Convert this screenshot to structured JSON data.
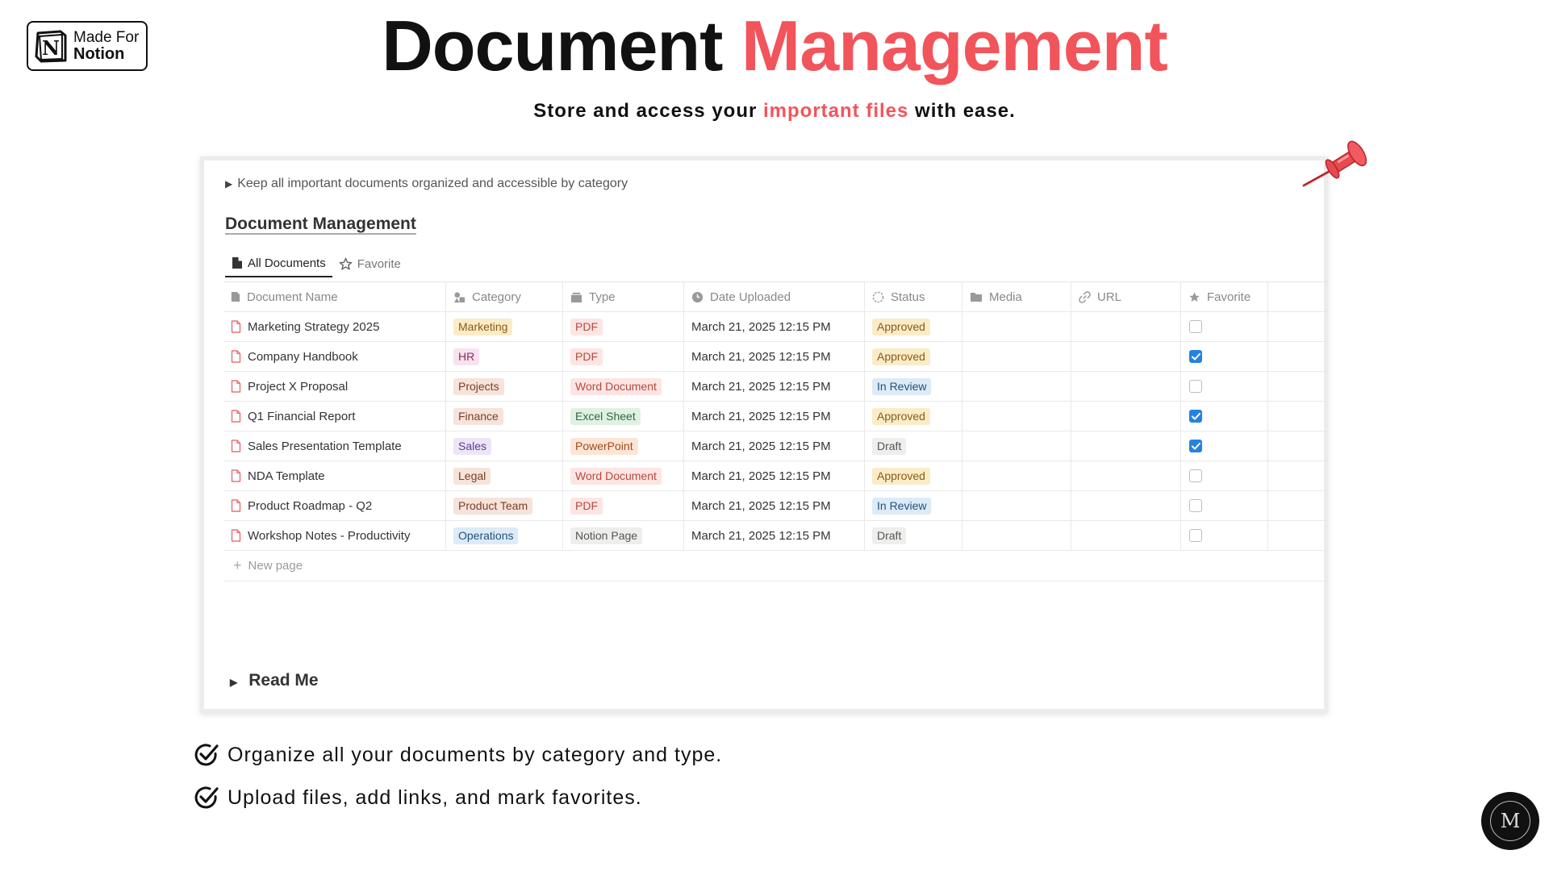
{
  "badge": {
    "line1": "Made For",
    "line2": "Notion",
    "logo_letter": "N"
  },
  "header": {
    "title_plain": "Document",
    "title_accent": "Management",
    "subtitle_pre": "Store and access your",
    "subtitle_accent": "important files",
    "subtitle_post": "with ease."
  },
  "colors": {
    "accent": "#f2545b",
    "checkbox_on": "#2383e2"
  },
  "panel": {
    "toggle_text": "Keep all important documents organized and accessible by category",
    "db_title": "Document Management",
    "tabs": [
      {
        "label": "All Documents",
        "icon": "document-icon",
        "active": true
      },
      {
        "label": "Favorite",
        "icon": "star-icon",
        "active": false
      }
    ],
    "columns": [
      {
        "label": "Document Name",
        "icon": "document-icon"
      },
      {
        "label": "Category",
        "icon": "shapes-icon"
      },
      {
        "label": "Type",
        "icon": "layers-icon"
      },
      {
        "label": "Date Uploaded",
        "icon": "clock-icon"
      },
      {
        "label": "Status",
        "icon": "status-icon"
      },
      {
        "label": "Media",
        "icon": "folder-icon"
      },
      {
        "label": "URL",
        "icon": "link-icon"
      },
      {
        "label": "Favorite",
        "icon": "star-icon"
      }
    ],
    "rows": [
      {
        "name": "Marketing Strategy 2025",
        "category": "Marketing",
        "type": "PDF",
        "date": "March 21, 2025 12:15 PM",
        "status": "Approved",
        "favorite": false
      },
      {
        "name": "Company Handbook",
        "category": "HR",
        "type": "PDF",
        "date": "March 21, 2025 12:15 PM",
        "status": "Approved",
        "favorite": true
      },
      {
        "name": "Project X Proposal",
        "category": "Projects",
        "type": "Word Document",
        "date": "March 21, 2025 12:15 PM",
        "status": "In Review",
        "favorite": false
      },
      {
        "name": "Q1 Financial Report",
        "category": "Finance",
        "type": "Excel Sheet",
        "date": "March 21, 2025 12:15 PM",
        "status": "Approved",
        "favorite": true
      },
      {
        "name": "Sales Presentation Template",
        "category": "Sales",
        "type": "PowerPoint",
        "date": "March 21, 2025 12:15 PM",
        "status": "Draft",
        "favorite": true
      },
      {
        "name": "NDA Template",
        "category": "Legal",
        "type": "Word Document",
        "date": "March 21, 2025 12:15 PM",
        "status": "Approved",
        "favorite": false
      },
      {
        "name": "Product Roadmap - Q2",
        "category": "Product Team",
        "type": "PDF",
        "date": "March 21, 2025 12:15 PM",
        "status": "In Review",
        "favorite": false
      },
      {
        "name": "Workshop Notes - Productivity",
        "category": "Operations",
        "type": "Notion Page",
        "date": "March 21, 2025 12:15 PM",
        "status": "Draft",
        "favorite": false
      }
    ],
    "tag_colors": {
      "Marketing": [
        "#fbecc8",
        "#8a5a14"
      ],
      "HR": [
        "#f9e2ef",
        "#8a2d5e"
      ],
      "Projects": [
        "#f6e3da",
        "#7a3f26"
      ],
      "Finance": [
        "#f6e3da",
        "#7a3f26"
      ],
      "Sales": [
        "#ece4f7",
        "#5b3d8a"
      ],
      "Legal": [
        "#f6e3da",
        "#7a3f26"
      ],
      "Product Team": [
        "#f6e3da",
        "#7a3f26"
      ],
      "Operations": [
        "#dcebf7",
        "#22527a"
      ],
      "PDF": [
        "#fde5e3",
        "#b34a3f"
      ],
      "Word Document": [
        "#fde5e3",
        "#b34a3f"
      ],
      "Excel Sheet": [
        "#dff1e3",
        "#2d6a3e"
      ],
      "PowerPoint": [
        "#fde5d6",
        "#a04a1c"
      ],
      "Notion Page": [
        "#eeeeec",
        "#555555"
      ],
      "Approved": [
        "#fbecc8",
        "#8a5a14"
      ],
      "In Review": [
        "#dcebf7",
        "#22527a"
      ],
      "Draft": [
        "#eeeeec",
        "#555555"
      ]
    },
    "new_page_label": "New page",
    "readme_label": "Read Me"
  },
  "features": [
    "Organize all your documents by category and type.",
    "Upload files, add links, and mark favorites."
  ],
  "author_logo_letter": "M"
}
